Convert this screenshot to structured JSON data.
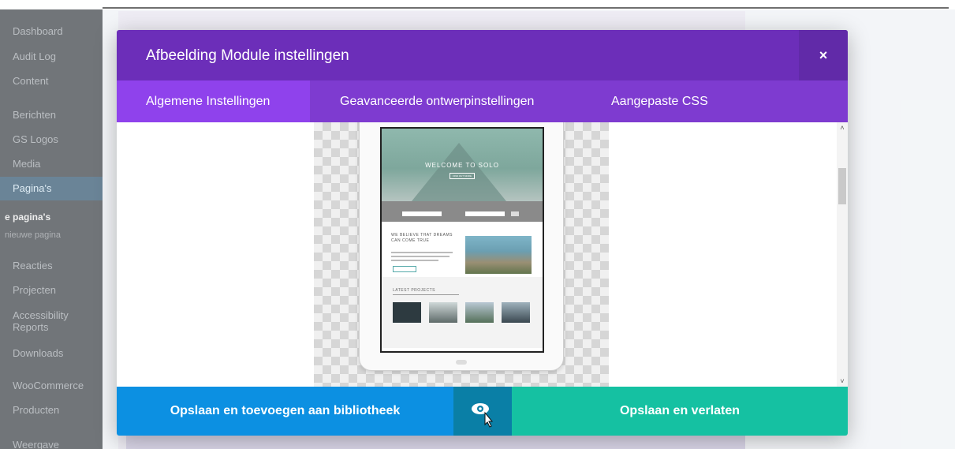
{
  "sidebar": {
    "items": [
      {
        "label": "Dashboard"
      },
      {
        "label": "Audit Log"
      },
      {
        "label": "Content"
      },
      {
        "label": "Berichten"
      },
      {
        "label": "GS Logos"
      },
      {
        "label": "Media"
      },
      {
        "label": "Pagina's"
      },
      {
        "label": "e pagina's"
      },
      {
        "label": "nieuwe pagina"
      },
      {
        "label": "Reacties"
      },
      {
        "label": "Projecten"
      },
      {
        "label": "Accessibility Reports"
      },
      {
        "label": "Downloads"
      },
      {
        "label": "WooCommerce"
      },
      {
        "label": "Producten"
      },
      {
        "label": "Weergave"
      }
    ]
  },
  "modal": {
    "title": "Afbeelding Module instellingen",
    "close_label": "×",
    "tabs": [
      {
        "label": "Algemene Instellingen",
        "active": true
      },
      {
        "label": "Geavanceerde ontwerpinstellingen",
        "active": false
      },
      {
        "label": "Aangepaste CSS",
        "active": false
      }
    ],
    "scroll_up": "˄",
    "scroll_down": "˅",
    "preview": {
      "hero_title": "WELCOME TO SOLO",
      "hero_button": "FIND OUT MORE",
      "content_heading": "WE BELIEVE THAT DREAMS CAN COME TRUE",
      "projects_heading": "LATEST PROJECTS"
    },
    "footer": {
      "library_label": "Opslaan en toevoegen aan bibliotheek",
      "preview_icon": "eye-cursor-icon",
      "save_label": "Opslaan en verlaten"
    }
  },
  "colors": {
    "header": "#6c2eb9",
    "tabs": "#7e3bd0",
    "tab_active": "#8f42ec",
    "library_button": "#0c90e2",
    "preview_button": "#0a7fa6",
    "save_button": "#15c1a2"
  }
}
